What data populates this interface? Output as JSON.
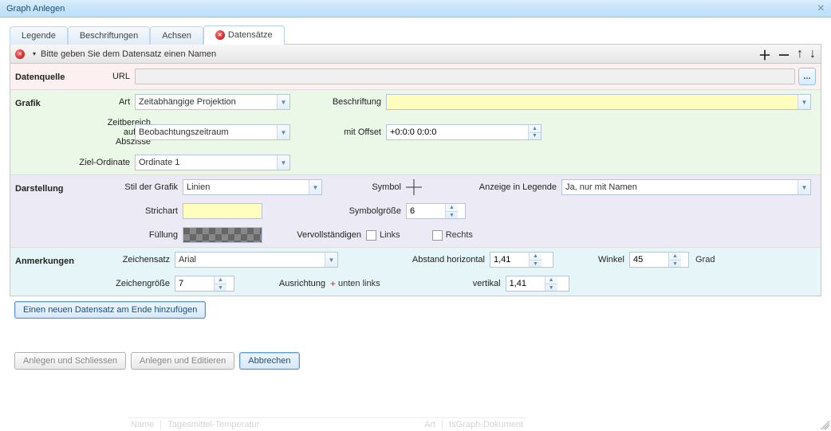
{
  "window": {
    "title": "Graph Anlegen"
  },
  "tabs": {
    "legende": "Legende",
    "beschriftungen": "Beschriftungen",
    "achsen": "Achsen",
    "datensaetze": "Datensätze"
  },
  "sectionBar": {
    "message": "Bitte geben Sie dem Datensatz einen Namen"
  },
  "datenquelle": {
    "block": "Datenquelle",
    "url_label": "URL",
    "browse": "..."
  },
  "grafik": {
    "block": "Grafik",
    "art_label": "Art",
    "art_value": "Zeitabhängige Projektion",
    "beschriftung_label": "Beschriftung",
    "beschriftung_value": "",
    "zeitbereich_label": "Zeitbereich auf der Abszisse",
    "zeitbereich_value": "Beobachtungszeitraum",
    "offset_label": "mit Offset",
    "offset_value": "+0:0:0 0:0:0",
    "zielOrd_label": "Ziel-Ordinate",
    "zielOrd_value": "Ordinate 1"
  },
  "darstellung": {
    "block": "Darstellung",
    "stil_label": "Stil der Grafik",
    "stil_value": "Linien",
    "symbol_label": "Symbol",
    "legend_label": "Anzeige in Legende",
    "legend_value": "Ja, nur mit Namen",
    "strichart_label": "Strichart",
    "symgroesse_label": "Symbolgröße",
    "symgroesse_value": "6",
    "fuellung_label": "Füllung",
    "vervoll_label": "Vervollständigen",
    "links": "Links",
    "rechts": "Rechts"
  },
  "anmerkungen": {
    "block": "Anmerkungen",
    "zeichensatz_label": "Zeichensatz",
    "zeichensatz_value": "Arial",
    "abst_h_label": "Abstand horizontal",
    "abst_h_value": "1,41",
    "winkel_label": "Winkel",
    "winkel_value": "45",
    "grad": "Grad",
    "zeichengroesse_label": "Zeichengröße",
    "zeichengroesse_value": "7",
    "ausrichtung_label": "Ausrichtung",
    "ausrichtung_value": "unten links",
    "vertikal_label": "vertikal",
    "vertikal_value": "1,41"
  },
  "addRow": "Einen neuen Datensatz am Ende hinzufügen",
  "footer": {
    "anlegenSchliessen": "Anlegen und Schliessen",
    "anlegenEditieren": "Anlegen und Editieren",
    "abbrechen": "Abbrechen"
  },
  "background": {
    "col1": "Name",
    "val1": "Tagesmittel-Temperatur",
    "col2": "Art",
    "val2": "tsGraph-Dokument"
  }
}
